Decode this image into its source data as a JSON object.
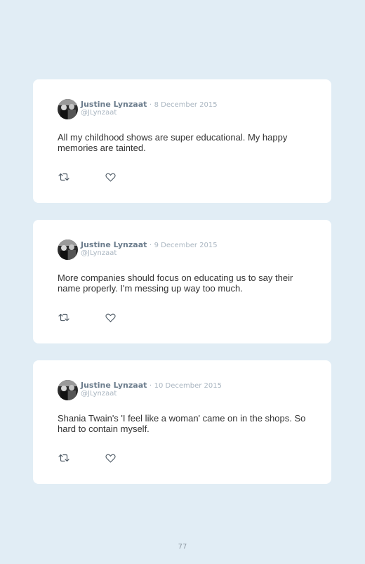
{
  "tweets": [
    {
      "author": "Justine Lynzaat",
      "separator": "·",
      "date": "8 December 2015",
      "handle": "@JLynzaat",
      "text": "All my childhood shows are super educational. My happy memories are tainted."
    },
    {
      "author": "Justine Lynzaat",
      "separator": "·",
      "date": "9 December 2015",
      "handle": "@JLynzaat",
      "text": "More companies should focus on educating us to say their name properly. I'm messing up way too much."
    },
    {
      "author": "Justine Lynzaat",
      "separator": "·",
      "date": "10 December 2015",
      "handle": "@JLynzaat",
      "text": "Shania Twain's 'I feel like a woman' came on in the shops. So hard to contain myself."
    }
  ],
  "icons": {
    "retweet": "retweet-icon",
    "like": "heart-icon"
  },
  "colors": {
    "background": "#e1edf5",
    "card": "#ffffff",
    "author": "#6b7c8c",
    "meta": "#aab6c1"
  },
  "page_number": "77"
}
